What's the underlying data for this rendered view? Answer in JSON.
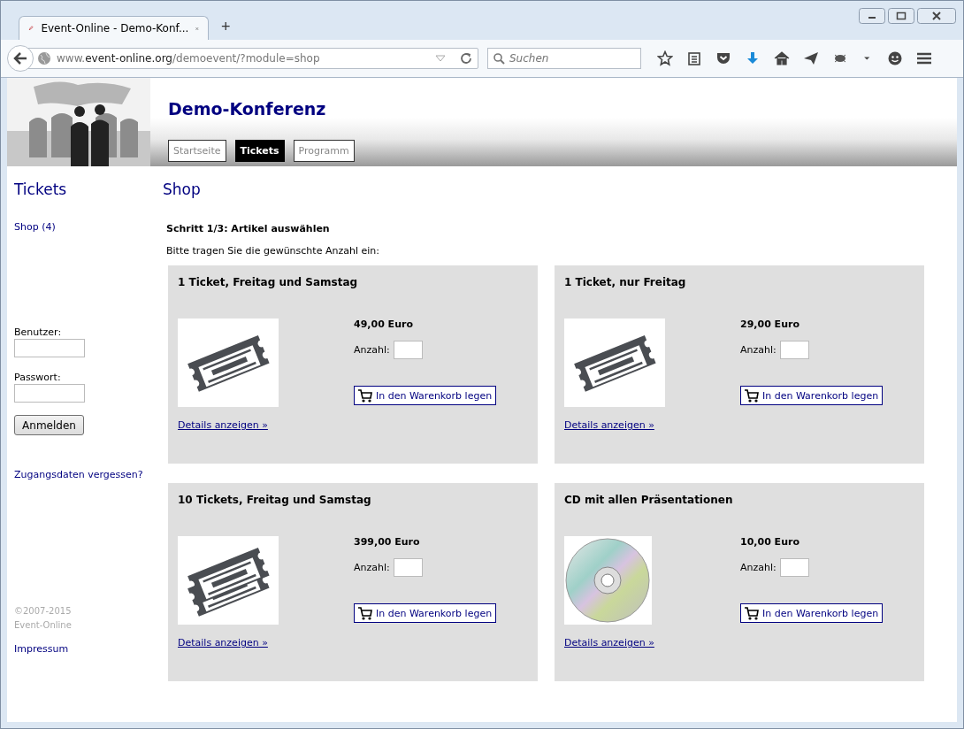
{
  "browser": {
    "tab_title": "Event-Online - Demo-Konf...",
    "new_tab": "+",
    "url": "www.**event-online.org**/demoevent/?module=shop",
    "search": {
      "placeholder": "Suchen"
    }
  },
  "header": {
    "title": "Demo-Konferenz",
    "nav": [
      {
        "label": "Startseite",
        "selected": false
      },
      {
        "label": "Tickets",
        "selected": true
      },
      {
        "label": "Programm",
        "selected": false
      }
    ]
  },
  "sidebar": {
    "heading": "Tickets",
    "links": [
      "Shop (4)"
    ],
    "login": {
      "user_label": "Benutzer:",
      "password_label": "Passwort:",
      "button": "Anmelden",
      "forgot": "Zugangsdaten vergessen?"
    },
    "copyright": [
      "©2007-2015",
      "Event-Online"
    ],
    "impressum": "Impressum"
  },
  "main": {
    "heading": "Shop",
    "step": "Schritt 1/3: Artikel auswählen",
    "instruction": "Bitte tragen Sie die gewünschte Anzahl ein:",
    "products": [
      {
        "kind": "ticket",
        "title": "1 Ticket, Freitag und Samstag",
        "price": "49,00 Euro",
        "qty_label": "Anzahl:",
        "cart_button": "In den Warenkorb legen",
        "details": "Details anzeigen »"
      },
      {
        "kind": "ticket",
        "title": "1 Ticket, nur Freitag",
        "price": "29,00 Euro",
        "qty_label": "Anzahl:",
        "cart_button": "In den Warenkorb legen",
        "details": "Details anzeigen »"
      },
      {
        "kind": "tickets",
        "title": "10 Tickets, Freitag und Samstag",
        "price": "399,00 Euro",
        "qty_label": "Anzahl:",
        "cart_button": "In den Warenkorb legen",
        "details": "Details anzeigen »"
      },
      {
        "kind": "cd",
        "title": "CD mit allen Präsentationen",
        "price": "10,00 Euro",
        "qty_label": "Anzahl:",
        "cart_button": "In den Warenkorb legen",
        "details": "Details anzeigen »"
      }
    ]
  }
}
